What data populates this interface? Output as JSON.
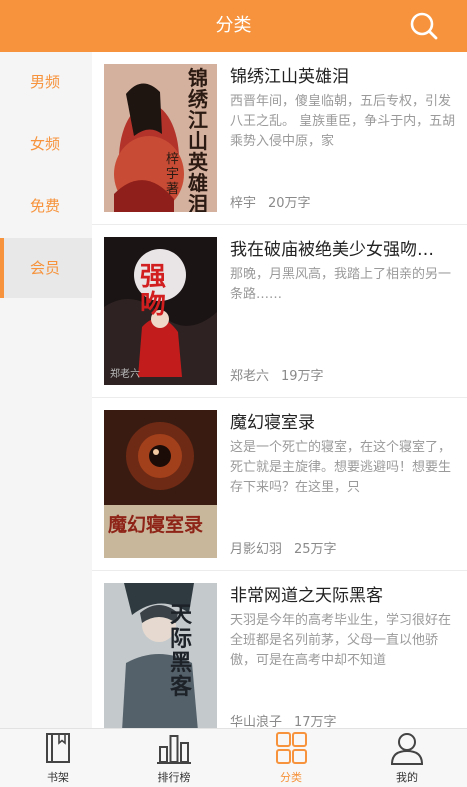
{
  "header": {
    "title": "分类",
    "search_icon": "search-icon"
  },
  "sidebar": {
    "items": [
      {
        "label": "男频",
        "active": false
      },
      {
        "label": "女频",
        "active": false
      },
      {
        "label": "免费",
        "active": false
      },
      {
        "label": "会员",
        "active": true
      }
    ]
  },
  "books": [
    {
      "title": "锦绣江山英雄泪",
      "desc": "西晋年间，傻皇临朝，五后专权，引发八王之乱。 皇族重臣，争斗于内，五胡乘势入侵中原，家",
      "author": "梓宇",
      "count": "20万字",
      "cover_text": "锦绣江山英雄泪",
      "cover_author": "梓宇 著"
    },
    {
      "title": "我在破庙被绝美少女强吻…",
      "desc": "那晚，月黑风高，我踏上了相亲的另一条路……",
      "author": "郑老六",
      "count": "19万字",
      "cover_text": "强吻",
      "cover_author": "郑老六"
    },
    {
      "title": "魔幻寝室录",
      "desc": "这是一个死亡的寝室，在这个寝室了，死亡就是主旋律。想要逃避吗！想要生存下来吗？在这里，只",
      "author": "月影幻羽",
      "count": "25万字",
      "cover_text": "魔幻寝室录",
      "cover_author": ""
    },
    {
      "title": "非常网道之天际黑客",
      "desc": "天羽是今年的高考毕业生，学习很好在全班都是名列前茅，父母一直以他骄傲，可是在高考中却不知道",
      "author": "华山浪子",
      "count": "17万字",
      "cover_text": "天际黑客",
      "cover_author": ""
    }
  ],
  "tabbar": {
    "items": [
      {
        "label": "书架",
        "icon": "bookshelf-icon",
        "active": false
      },
      {
        "label": "排行榜",
        "icon": "ranking-icon",
        "active": false
      },
      {
        "label": "分类",
        "icon": "category-icon",
        "active": true
      },
      {
        "label": "我的",
        "icon": "profile-icon",
        "active": false
      }
    ]
  },
  "colors": {
    "accent": "#f6933c",
    "sidebar_bg": "#f5f5f5",
    "title": "#222222",
    "desc": "#9a9a9a"
  }
}
